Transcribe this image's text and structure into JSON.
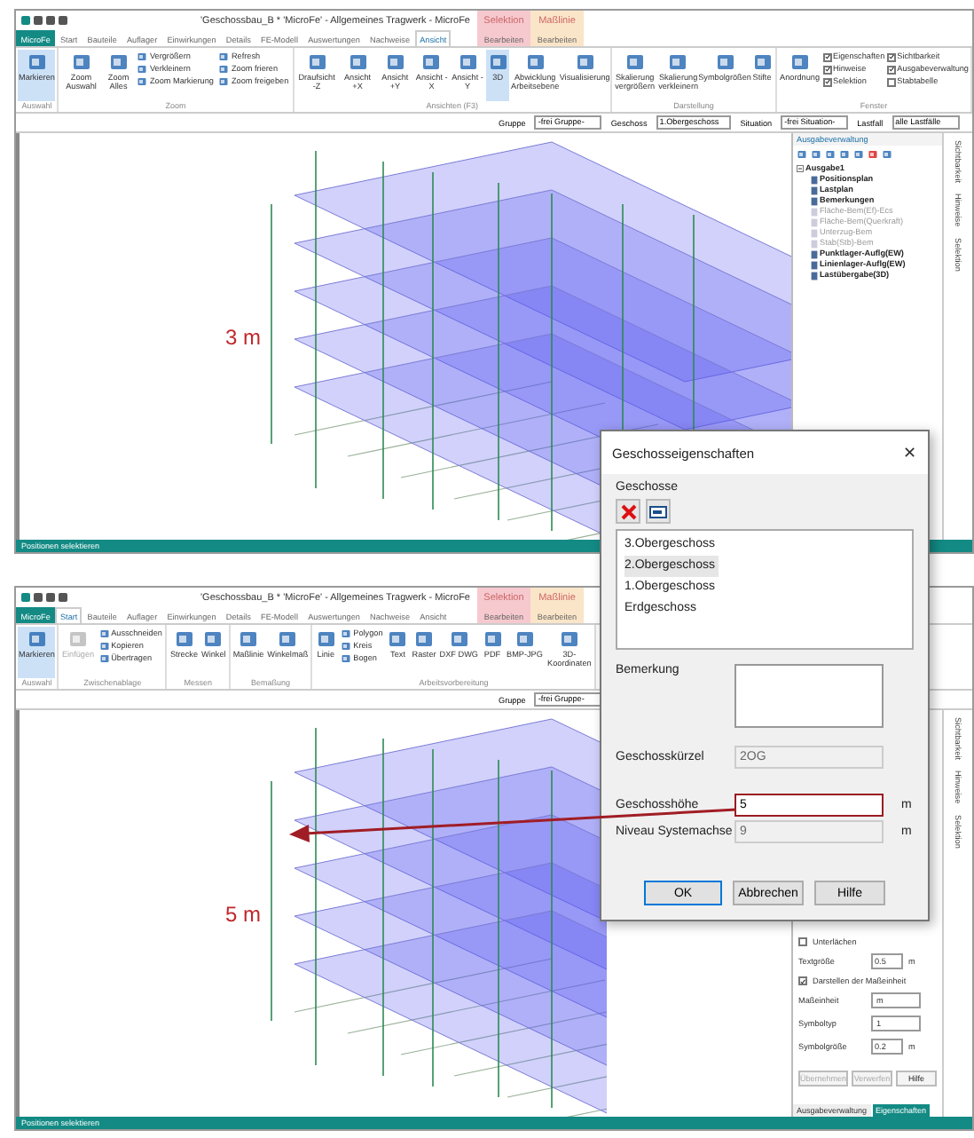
{
  "windows": [
    {
      "title": "'Geschossbau_B * 'MicroFe' - Allgemeines Tragwerk - MicroFe",
      "context_tabs": [
        {
          "group": "Selektion",
          "label": "Bearbeiten",
          "color": "#f6c9cf"
        },
        {
          "group": "Maßlinie",
          "label": "Bearbeiten",
          "color": "#fbe5c8"
        }
      ],
      "tabs": [
        {
          "label": "MicroFe",
          "kind": "app",
          "selected": false
        },
        {
          "label": "Start",
          "kind": "tab",
          "selected": false
        },
        {
          "label": "Bauteile",
          "kind": "tab",
          "selected": false
        },
        {
          "label": "Auflager",
          "kind": "tab",
          "selected": false
        },
        {
          "label": "Einwirkungen",
          "kind": "tab",
          "selected": false
        },
        {
          "label": "Details",
          "kind": "tab",
          "selected": false
        },
        {
          "label": "FE-Modell",
          "kind": "tab",
          "selected": false
        },
        {
          "label": "Auswertungen",
          "kind": "tab",
          "selected": false
        },
        {
          "label": "Nachweise",
          "kind": "tab",
          "selected": false
        },
        {
          "label": "Ansicht",
          "kind": "tab",
          "selected": true
        }
      ],
      "ribbon": [
        {
          "group": "Auswahl",
          "items": [
            {
              "kind": "large",
              "label": "Markieren",
              "active": true,
              "disabled": false
            }
          ]
        },
        {
          "group": "Zoom",
          "items": [
            {
              "kind": "large",
              "label": "Zoom Auswahl",
              "active": false,
              "disabled": false
            },
            {
              "kind": "large",
              "label": "Zoom Alles",
              "active": false,
              "disabled": false
            },
            {
              "kind": "small",
              "label": "Vergrößern",
              "active": false,
              "disabled": false
            },
            {
              "kind": "small",
              "label": "Verkleinern",
              "active": false,
              "disabled": false
            },
            {
              "kind": "small",
              "label": "Zoom Markierung",
              "active": false,
              "disabled": false
            },
            {
              "kind": "small",
              "label": "Refresh",
              "active": false,
              "disabled": false
            },
            {
              "kind": "small",
              "label": "Zoom frieren",
              "active": false,
              "disabled": false
            },
            {
              "kind": "small",
              "label": "Zoom freigeben",
              "active": false,
              "disabled": false
            }
          ]
        },
        {
          "group": "Ansichten (F3)",
          "items": [
            {
              "kind": "large",
              "label": "Draufsicht -Z",
              "active": false,
              "disabled": false
            },
            {
              "kind": "large",
              "label": "Ansicht +X",
              "active": false,
              "disabled": false
            },
            {
              "kind": "large",
              "label": "Ansicht +Y",
              "active": false,
              "disabled": false
            },
            {
              "kind": "large",
              "label": "Ansicht -X",
              "active": false,
              "disabled": false
            },
            {
              "kind": "large",
              "label": "Ansicht -Y",
              "active": false,
              "disabled": false
            },
            {
              "kind": "large",
              "label": "3D",
              "active": true,
              "disabled": false
            },
            {
              "kind": "large",
              "label": "Abwicklung Arbeitsebene",
              "active": false,
              "disabled": false
            },
            {
              "kind": "large",
              "label": "Visualisierung",
              "active": false,
              "disabled": false
            }
          ]
        },
        {
          "group": "Darstellung",
          "items": [
            {
              "kind": "large",
              "label": "Skalierung vergrößern",
              "active": false,
              "disabled": false
            },
            {
              "kind": "large",
              "label": "Skalierung verkleinern",
              "active": false,
              "disabled": false
            },
            {
              "kind": "large",
              "label": "Symbolgrößen",
              "active": false,
              "disabled": false
            },
            {
              "kind": "large",
              "label": "Stifte",
              "active": false,
              "disabled": false
            }
          ]
        },
        {
          "group": "Fenster",
          "items": [
            {
              "kind": "large",
              "label": "Anordnung",
              "active": false,
              "disabled": false
            },
            {
              "kind": "check",
              "label": "Eigenschaften",
              "checked": true
            },
            {
              "kind": "check",
              "label": "Hinweise",
              "checked": true
            },
            {
              "kind": "check",
              "label": "Selektion",
              "checked": true
            },
            {
              "kind": "check",
              "label": "Sichtbarkeit",
              "checked": true
            },
            {
              "kind": "check",
              "label": "Ausgabeverwaltung",
              "checked": true
            },
            {
              "kind": "check",
              "label": "Stabtabelle",
              "checked": false
            }
          ]
        }
      ],
      "toolbar": [
        {
          "label": "Gruppe",
          "value": "-frei Gruppe-"
        },
        {
          "label": "Geschoss",
          "value": "1.Obergeschoss"
        },
        {
          "label": "Situation",
          "value": "-frei Situation-"
        },
        {
          "label": "Lastfall",
          "value": "alle Lastfälle"
        }
      ],
      "annotation": "3 m",
      "panel": {
        "kind": "tree",
        "title": "Ausgabeverwaltung",
        "tree": [
          {
            "label": "Ausgabe1",
            "expanded": true,
            "disabled": false,
            "children": [
              {
                "label": "Positionsplan",
                "disabled": false
              },
              {
                "label": "Lastplan",
                "disabled": false
              },
              {
                "label": "Bemerkungen",
                "disabled": false
              },
              {
                "label": "Fläche-Bem(Ef)-Ecs",
                "disabled": true
              },
              {
                "label": "Fläche-Bem(Querkraft)",
                "disabled": true
              },
              {
                "label": "Unterzug-Bem",
                "disabled": true
              },
              {
                "label": "Stab(Stb)-Bem",
                "disabled": true
              },
              {
                "label": "Punktlager-Auflg(EW)",
                "disabled": false
              },
              {
                "label": "Linienlager-Auflg(EW)",
                "disabled": false
              },
              {
                "label": "Lastübergabe(3D)",
                "disabled": false
              }
            ]
          }
        ]
      },
      "side_tabs": [
        "Sichtbarkeit",
        "Hinweise",
        "Selektion"
      ],
      "status": "Positionen selektieren"
    },
    {
      "title": "'Geschossbau_B * 'MicroFe' - Allgemeines Tragwerk - MicroFe",
      "context_tabs": [
        {
          "group": "Selektion",
          "label": "Bearbeiten",
          "color": "#f6c9cf"
        },
        {
          "group": "Maßlinie",
          "label": "Bearbeiten",
          "color": "#fbe5c8"
        }
      ],
      "tabs": [
        {
          "label": "MicroFe",
          "kind": "app",
          "selected": false
        },
        {
          "label": "Start",
          "kind": "tab",
          "selected": true
        },
        {
          "label": "Bauteile",
          "kind": "tab",
          "selected": false
        },
        {
          "label": "Auflager",
          "kind": "tab",
          "selected": false
        },
        {
          "label": "Einwirkungen",
          "kind": "tab",
          "selected": false
        },
        {
          "label": "Details",
          "kind": "tab",
          "selected": false
        },
        {
          "label": "FE-Modell",
          "kind": "tab",
          "selected": false
        },
        {
          "label": "Auswertungen",
          "kind": "tab",
          "selected": false
        },
        {
          "label": "Nachweise",
          "kind": "tab",
          "selected": false
        },
        {
          "label": "Ansicht",
          "kind": "tab",
          "selected": false
        }
      ],
      "ribbon": [
        {
          "group": "Auswahl",
          "items": [
            {
              "kind": "large",
              "label": "Markieren",
              "active": true,
              "disabled": false
            }
          ]
        },
        {
          "group": "Zwischenablage",
          "items": [
            {
              "kind": "large",
              "label": "Einfügen",
              "active": false,
              "disabled": true
            },
            {
              "kind": "small",
              "label": "Ausschneiden",
              "active": false,
              "disabled": false
            },
            {
              "kind": "small",
              "label": "Kopieren",
              "active": false,
              "disabled": false
            },
            {
              "kind": "small",
              "label": "Übertragen",
              "active": false,
              "disabled": false
            }
          ]
        },
        {
          "group": "Messen",
          "items": [
            {
              "kind": "large",
              "label": "Strecke",
              "active": false,
              "disabled": false
            },
            {
              "kind": "large",
              "label": "Winkel",
              "active": false,
              "disabled": false
            }
          ]
        },
        {
          "group": "Bemaßung",
          "items": [
            {
              "kind": "large",
              "label": "Maßlinie",
              "active": false,
              "disabled": false
            },
            {
              "kind": "large",
              "label": "Winkelmaß",
              "active": false,
              "disabled": false
            }
          ]
        },
        {
          "group": "Arbeitsvorbereitung",
          "items": [
            {
              "kind": "large",
              "label": "Linie",
              "active": false,
              "disabled": false
            },
            {
              "kind": "small",
              "label": "Polygon",
              "active": false,
              "disabled": false
            },
            {
              "kind": "small",
              "label": "Kreis",
              "active": false,
              "disabled": false
            },
            {
              "kind": "small",
              "label": "Bogen",
              "active": false,
              "disabled": false
            },
            {
              "kind": "large",
              "label": "Text",
              "active": false,
              "disabled": false
            },
            {
              "kind": "large",
              "label": "Raster",
              "active": false,
              "disabled": false
            },
            {
              "kind": "large",
              "label": "DXF DWG",
              "active": false,
              "disabled": false
            },
            {
              "kind": "large",
              "label": "PDF",
              "active": false,
              "disabled": false
            },
            {
              "kind": "large",
              "label": "BMP-JPG",
              "active": false,
              "disabled": false
            },
            {
              "kind": "large",
              "label": "3D-Koordinaten",
              "active": false,
              "disabled": false
            }
          ]
        }
      ],
      "toolbar": [
        {
          "label": "Gruppe",
          "value": "-frei Gruppe-"
        }
      ],
      "annotation": "5 m",
      "panel": {
        "kind": "properties",
        "rows": [
          {
            "kind": "check",
            "label": "Unterlächen",
            "checked": false
          },
          {
            "kind": "field",
            "label": "Textgröße",
            "value": "0.5",
            "unit": "m"
          },
          {
            "kind": "check",
            "label": "Darstellen der Maßeinheit",
            "checked": true
          },
          {
            "kind": "select",
            "label": "Maßeinheit",
            "value": "m"
          },
          {
            "kind": "select",
            "label": "Symboltyp",
            "value": "1"
          },
          {
            "kind": "field",
            "label": "Symbolgröße",
            "value": "0.2",
            "unit": "m"
          }
        ],
        "buttons": [
          {
            "label": "Übernehmen",
            "disabled": true
          },
          {
            "label": "Verwerfen",
            "disabled": true
          },
          {
            "label": "Hilfe",
            "disabled": false
          }
        ],
        "tabs": [
          {
            "label": "Ausgabeverwaltung",
            "selected": false
          },
          {
            "label": "Eigenschaften",
            "selected": true
          }
        ]
      },
      "side_tabs": [
        "Sichtbarkeit",
        "Hinweise",
        "Selektion"
      ],
      "status": "Positionen selektieren"
    }
  ],
  "dialog": {
    "title": "Geschosseigenschaften",
    "close": "✕",
    "section": "Geschosse",
    "storeys": [
      {
        "label": "3.Obergeschoss",
        "selected": false
      },
      {
        "label": "2.Obergeschoss",
        "selected": true
      },
      {
        "label": "1.Obergeschoss",
        "selected": false
      },
      {
        "label": "Erdgeschoss",
        "selected": false
      }
    ],
    "remark_label": "Bemerkung",
    "fields": [
      {
        "label": "Geschosskürzel",
        "value": "2OG",
        "disabled": true,
        "focused": false
      },
      {
        "label": "Geschosshöhe",
        "value": "5",
        "unit": "m",
        "disabled": false,
        "focused": true
      },
      {
        "label": "Niveau Systemachse",
        "value": "9",
        "unit": "m",
        "disabled": true,
        "focused": false
      }
    ],
    "buttons": [
      {
        "label": "OK",
        "default": true
      },
      {
        "label": "Abbrechen",
        "default": false
      },
      {
        "label": "Hilfe",
        "default": false
      }
    ]
  }
}
